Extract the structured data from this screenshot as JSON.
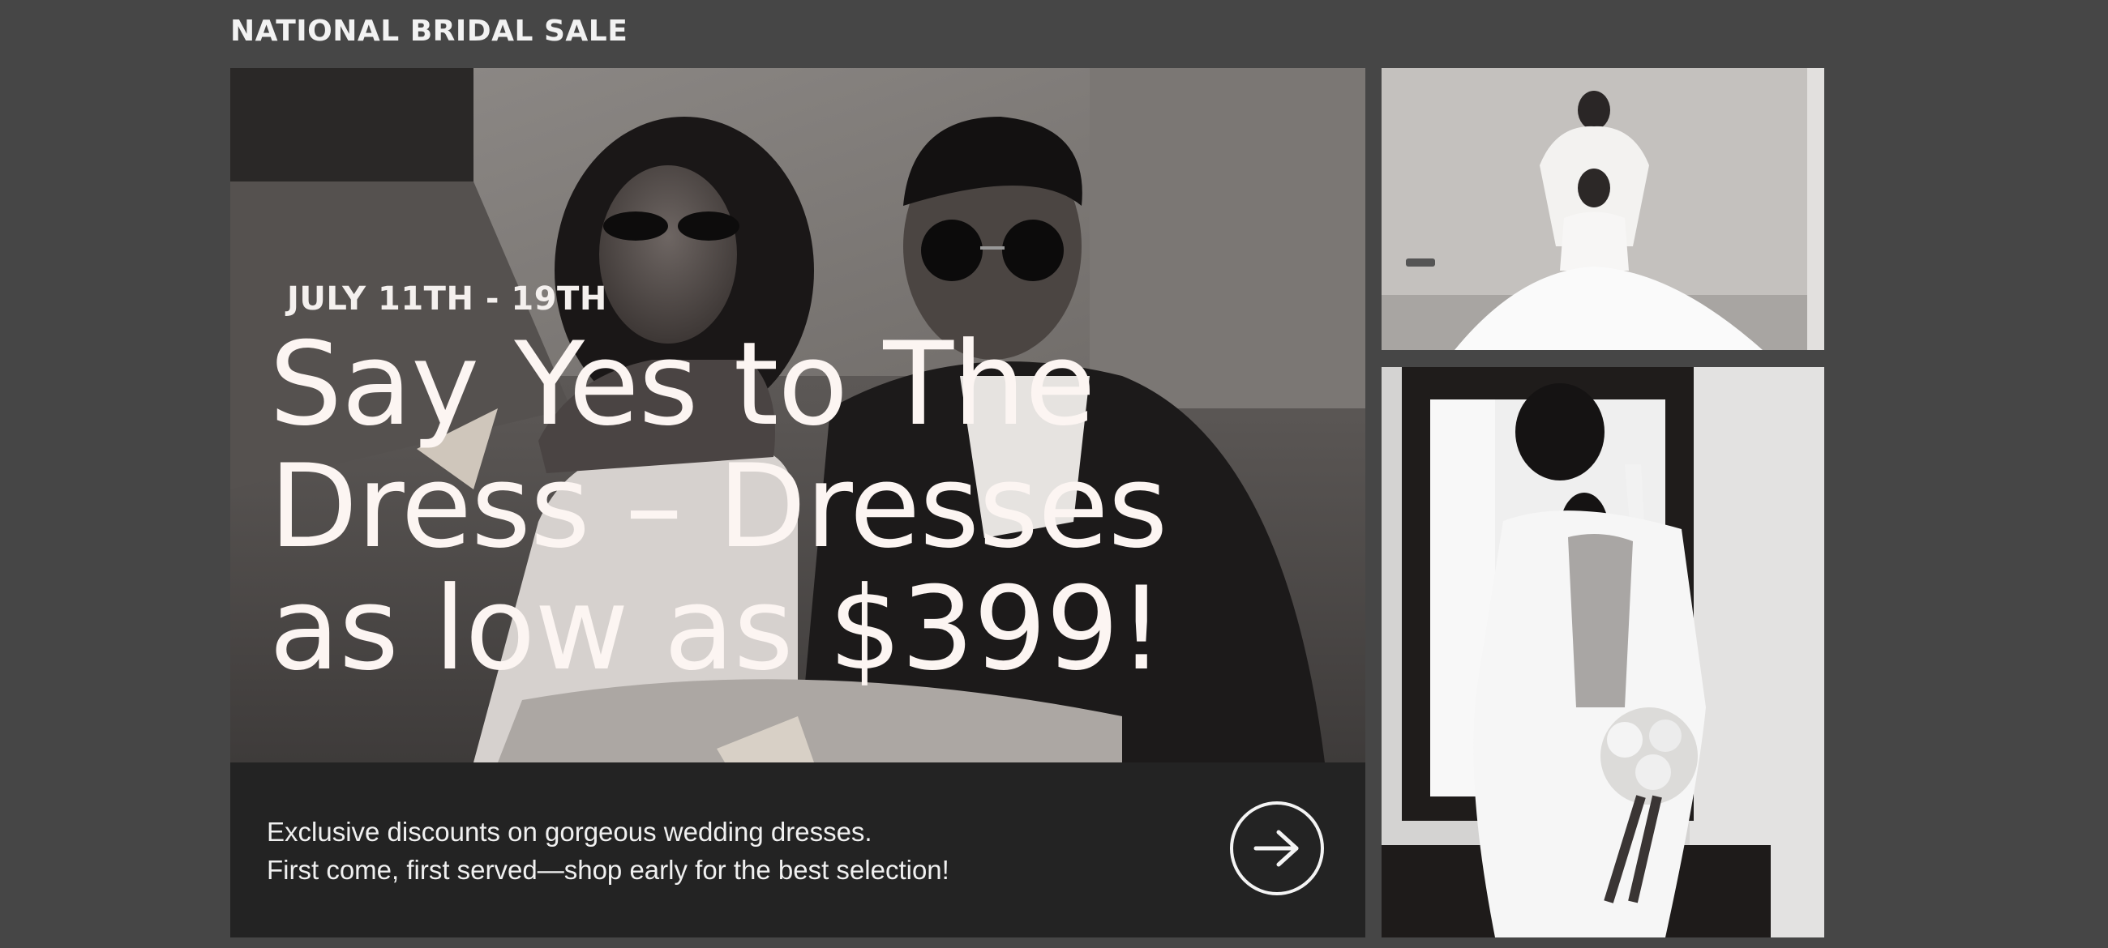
{
  "section": {
    "title": "NATIONAL BRIDAL SALE"
  },
  "hero": {
    "date": "JULY 11TH - 19TH",
    "heading_lines": [
      "Say Yes to The",
      "Dress – Dresses",
      "as low as $399!"
    ],
    "description_lines": [
      "Exclusive discounts on gorgeous wedding dresses.",
      "First come, first served—shop early for the best selection!"
    ],
    "image_alt": "Couple in sunglasses sitting at a table eating pizza, black and white photo",
    "cta_icon": "arrow-right-icon"
  },
  "side_images": [
    {
      "alt": "Two brides in white gowns posing in a concrete room"
    },
    {
      "alt": "Bride seen from behind in open-back dress holding a bouquet beside a mirror"
    }
  ]
}
